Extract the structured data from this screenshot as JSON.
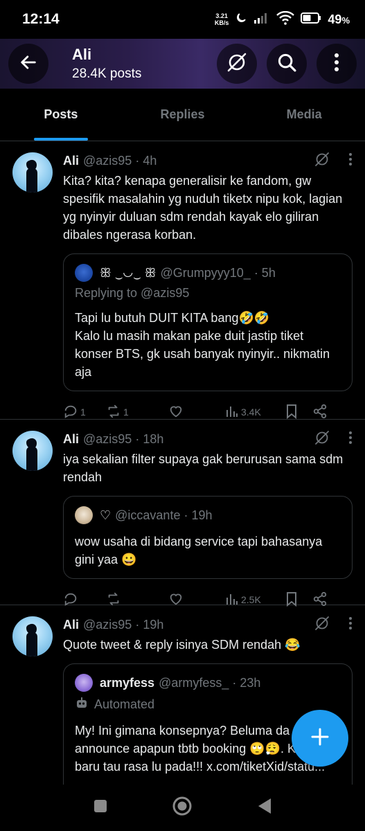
{
  "status": {
    "time": "12:14",
    "speed_value": "3.21",
    "speed_unit": "KB/s",
    "battery": "49",
    "battery_unit": "%"
  },
  "header": {
    "name": "Ali",
    "post_count": "28.4K posts"
  },
  "tabs": [
    {
      "label": "Posts",
      "active": true
    },
    {
      "label": "Replies",
      "active": false
    },
    {
      "label": "Media",
      "active": false
    }
  ],
  "posts": [
    {
      "name": "Ali",
      "handle": "@azis95 · 4h",
      "text": "Kita? kita? kenapa generalisir ke fandom, gw spesifik masalahin yg nuduh tiketx nipu kok, lagian yg nyinyir duluan sdm rendah kayak elo giliran dibales ngerasa korban.",
      "quote": {
        "name": "ꕥ ‿◡‿ ꕥ",
        "handle": "@Grumpyyy10_ · 5h",
        "sub": "Replying to @azis95",
        "text_line1": "Tapi lu butuh DUIT KITA bang🤣🤣",
        "text_line2": "Kalo lu masih makan pake duit jastip tiket konser BTS, gk usah banyak nyinyir.. nikmatin aja"
      },
      "replies": "1",
      "reposts": "1",
      "views": "3.4K"
    },
    {
      "name": "Ali",
      "handle": "@azis95 · 18h",
      "text": "iya sekalian filter supaya gak berurusan sama sdm rendah",
      "quote": {
        "name": "♡",
        "handle": "@iccavante · 19h",
        "text": "wow usaha di bidang service tapi bahasanya gini yaa 😀"
      },
      "replies": "",
      "reposts": "",
      "views": "2.5K"
    },
    {
      "name": "Ali",
      "handle": "@azis95 · 19h",
      "text": "Quote tweet & reply isinya SDM rendah 😂",
      "quote": {
        "name": "armyfess",
        "handle": "@armyfess_ · 23h",
        "sub": "Automated",
        "text": "My! Ini gimana konsepnya? Beluma da announce apapun tbtb booking 🙄😮‍💨. K scam baru tau rasa lu pada!!! x.com/tiketXid/statu..."
      }
    }
  ],
  "colors": {
    "accent": "#1d9bf0",
    "muted": "#71767b",
    "border": "#2f3336"
  }
}
